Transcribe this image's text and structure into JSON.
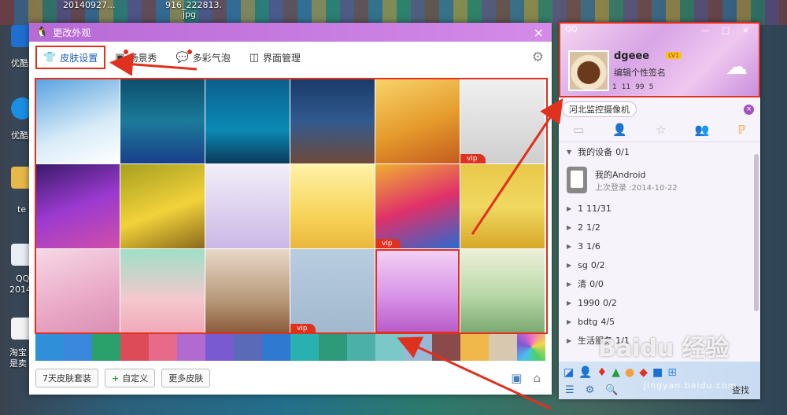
{
  "desktop": {
    "top_labels": [
      "20140927...",
      "916_222813.",
      "jpg"
    ],
    "icons": [
      {
        "label": "优酷",
        "color": "#1f6fd0"
      },
      {
        "label": "优酷",
        "color": "#1a8fe3"
      },
      {
        "label": "te",
        "color": "#e6b84a"
      },
      {
        "label": "QQ",
        "color": "#e9eef5"
      },
      {
        "label": "2014(",
        "color": ""
      },
      {
        "label": "淘宝",
        "color": "#f4f4f4"
      },
      {
        "label": "是卖",
        "color": ""
      }
    ]
  },
  "dialog": {
    "title": "更改外观",
    "close": "×",
    "tabs": [
      {
        "label": "皮肤设置",
        "icon": "tshirt-icon",
        "active": true
      },
      {
        "label": "场景秀",
        "icon": "scene-icon",
        "badge": true
      },
      {
        "label": "多彩气泡",
        "icon": "bubble-icon",
        "badge": true
      },
      {
        "label": "界面管理",
        "icon": "layout-icon"
      }
    ],
    "skins": [
      {
        "bg": "linear-gradient(160deg,#5aa3e0,#d8ecf8 60%,#fff)",
        "vip": ""
      },
      {
        "bg": "linear-gradient(180deg,#0d4f6e,#1b7a9a 50%,#1a3f8a)",
        "vip": ""
      },
      {
        "bg": "linear-gradient(180deg,#0c5f8f,#0a8ab5 60%,#0b3a5a)",
        "vip": ""
      },
      {
        "bg": "linear-gradient(180deg,#1a3b6a,#315a8f 50%,#6f4a3a)",
        "vip": ""
      },
      {
        "bg": "linear-gradient(160deg,#f8d36a,#e59a2b 55%,#c45b1f)",
        "vip": ""
      },
      {
        "bg": "linear-gradient(180deg,#f0f0f0,#cfcfcf)",
        "vip": "vip"
      },
      {
        "bg": "linear-gradient(160deg,#3a1a6a,#9b3ad0 50%,#d04fa8)",
        "vip": ""
      },
      {
        "bg": "linear-gradient(160deg,#a6a020,#f2d23a 55%,#8a6a1a)",
        "vip": ""
      },
      {
        "bg": "linear-gradient(180deg,#f2eef8,#cbb8e6)",
        "vip": ""
      },
      {
        "bg": "linear-gradient(180deg,#fff2a8,#f7d45a 60%,#e9b73a)",
        "vip": ""
      },
      {
        "bg": "linear-gradient(160deg,#f0b030,#e0306a 50%,#2a6ad0)",
        "vip": "vip"
      },
      {
        "bg": "linear-gradient(180deg,#e8c84a,#f0d860 50%,#d8a82a)",
        "vip": ""
      },
      {
        "bg": "linear-gradient(160deg,#f6d8e6,#e9a8c6 60%,#d98fb2)",
        "vip": ""
      },
      {
        "bg": "linear-gradient(180deg,#9fe0c8,#f4c8cc 60%,#f0a8b8)",
        "vip": ""
      },
      {
        "bg": "linear-gradient(180deg,#e8d8c8,#b89a7a 60%,#8a5a3a)",
        "vip": ""
      },
      {
        "bg": "linear-gradient(180deg,#b8cde0,#a2b8ce)",
        "vip": "vip"
      },
      {
        "bg": "linear-gradient(180deg,#f4d2f4,#d894e8 55%,#b85ac8)",
        "vip": "",
        "selected": true
      },
      {
        "bg": "linear-gradient(180deg,#eef0d8,#b8d8a8 55%,#7aa870)",
        "vip": ""
      }
    ],
    "swatches": [
      "#2f8fd8",
      "#3a88dd",
      "#2aa06a",
      "#dd4a58",
      "#e76a8a",
      "#b06ad0",
      "#7a5ad0",
      "#5a6ab8",
      "#2f7ad0",
      "#2ab0b0",
      "#2f9a7a",
      "#4ab0a8",
      "#7ac8c8",
      "#98b8d8",
      "#8a4a4a",
      "#f0b84a",
      "#d8c8b0",
      "#f06ac8"
    ],
    "buttons": {
      "seven_day": "7天皮肤套装",
      "custom": "自定义",
      "more": "更多皮肤"
    }
  },
  "qq": {
    "logo": "QQ",
    "window_controls": "— □ ×",
    "username": "dgeee",
    "level": "LV1",
    "signature": "编辑个性签名",
    "stats": [
      "1",
      "11",
      "99",
      "",
      "5"
    ],
    "search_text": "河北监控摄像机",
    "groups_head": {
      "label": "我的设备",
      "count": "0/1"
    },
    "device": {
      "name": "我的Android",
      "last_login": "上次登录 :2014-10-22"
    },
    "groups": [
      {
        "name": "1",
        "count": "11/31"
      },
      {
        "name": "2",
        "count": "1/2"
      },
      {
        "name": "3",
        "count": "1/6"
      },
      {
        "name": "sg",
        "count": "0/2"
      },
      {
        "name": "清",
        "count": "0/0"
      },
      {
        "name": "1990",
        "count": "0/2"
      },
      {
        "name": "bdtg",
        "count": "4/5"
      },
      {
        "name": "生活服务",
        "count": "1/1"
      }
    ],
    "find_label": "查找"
  },
  "watermark": {
    "text": "Baidu 经验",
    "sub": "jingyan.baidu.com"
  }
}
